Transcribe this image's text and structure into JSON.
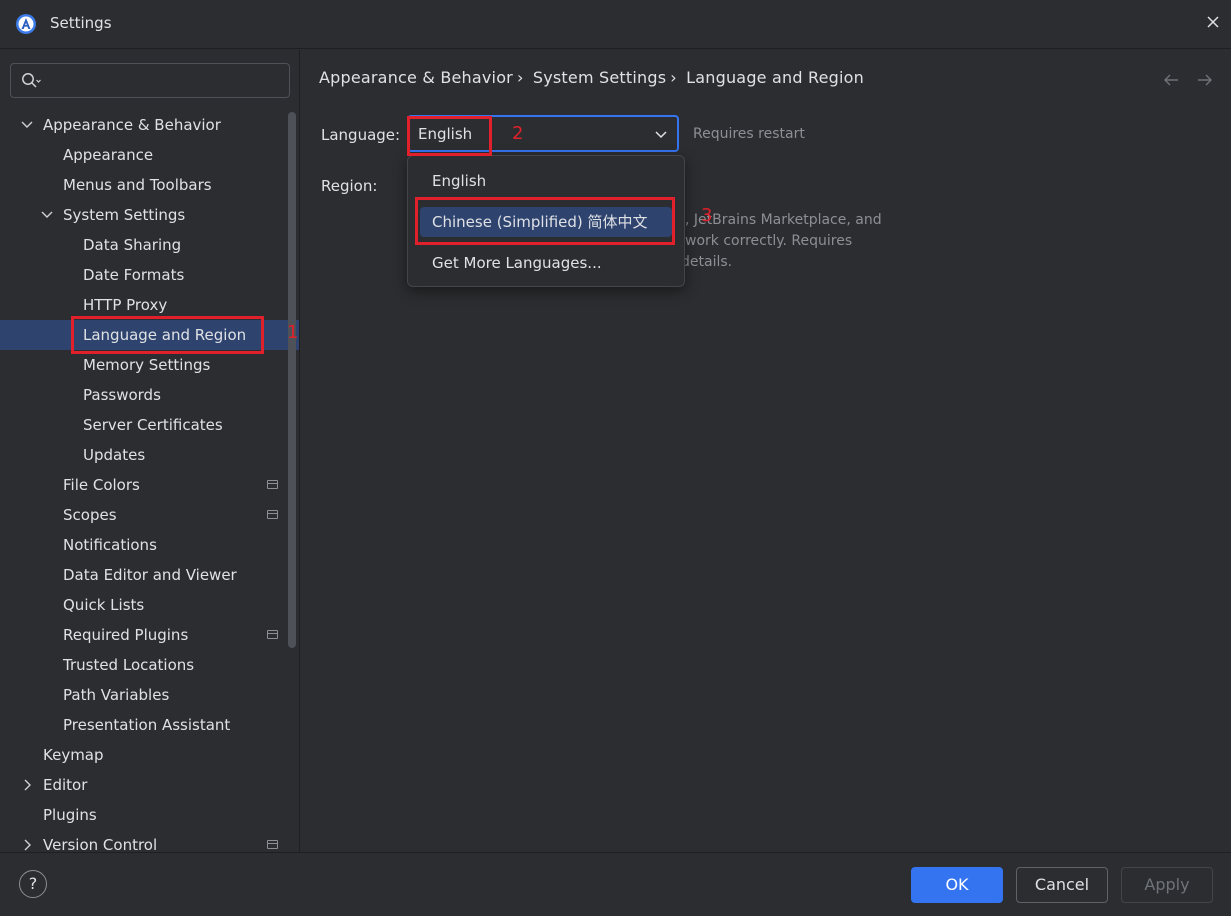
{
  "window": {
    "title": "Settings",
    "app_icon": "android-studio-icon"
  },
  "sidebar": {
    "search": {
      "placeholder": ""
    },
    "items": [
      {
        "label": "Appearance & Behavior",
        "level": 0,
        "expanded": true
      },
      {
        "label": "Appearance",
        "level": 1
      },
      {
        "label": "Menus and Toolbars",
        "level": 1
      },
      {
        "label": "System Settings",
        "level": 1,
        "expanded": true
      },
      {
        "label": "Data Sharing",
        "level": 2
      },
      {
        "label": "Date Formats",
        "level": 2
      },
      {
        "label": "HTTP Proxy",
        "level": 2
      },
      {
        "label": "Language and Region",
        "level": 2,
        "selected": true
      },
      {
        "label": "Memory Settings",
        "level": 2
      },
      {
        "label": "Passwords",
        "level": 2
      },
      {
        "label": "Server Certificates",
        "level": 2
      },
      {
        "label": "Updates",
        "level": 2
      },
      {
        "label": "File Colors",
        "level": 1,
        "badge": true
      },
      {
        "label": "Scopes",
        "level": 1,
        "badge": true
      },
      {
        "label": "Notifications",
        "level": 1
      },
      {
        "label": "Data Editor and Viewer",
        "level": 1
      },
      {
        "label": "Quick Lists",
        "level": 1
      },
      {
        "label": "Required Plugins",
        "level": 1,
        "badge": true
      },
      {
        "label": "Trusted Locations",
        "level": 1
      },
      {
        "label": "Path Variables",
        "level": 1
      },
      {
        "label": "Presentation Assistant",
        "level": 1
      },
      {
        "label": "Keymap",
        "level": 0
      },
      {
        "label": "Editor",
        "level": 0,
        "collapsed": true
      },
      {
        "label": "Plugins",
        "level": 0
      },
      {
        "label": "Version Control",
        "level": 0,
        "collapsed": true,
        "badge": true
      }
    ]
  },
  "content": {
    "breadcrumb": [
      "Appearance & Behavior",
      "System Settings",
      "Language and Region"
    ],
    "language_label": "Language:",
    "language_value": "English",
    "requires_restart": "Requires restart",
    "region_label": "Region:",
    "hint_lines": [
      ", JetBrains Marketplace, and",
      "work correctly. Requires",
      "details."
    ],
    "dropdown_options": [
      "English",
      "Chinese (Simplified) 简体中文",
      "Get More Languages..."
    ],
    "highlighted_option": 1
  },
  "annotations": {
    "num1": "1",
    "num2": "2",
    "num3": "3"
  },
  "footer": {
    "help": "?",
    "ok": "OK",
    "cancel": "Cancel",
    "apply": "Apply"
  },
  "colors": {
    "accent": "#3574f0",
    "selection": "#2e436e",
    "annotation_red": "#e0212c",
    "background": "#2b2d30"
  }
}
